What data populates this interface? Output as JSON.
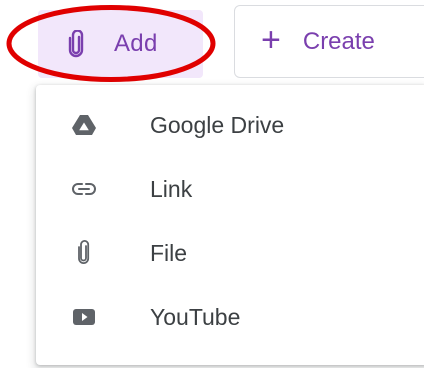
{
  "add_button": {
    "icon": "paperclip-icon",
    "label": "Add",
    "accent_color": "#7a3fae",
    "background_color": "#f2e7fb"
  },
  "create_button": {
    "icon": "plus-icon",
    "label": "Create"
  },
  "highlight": {
    "color": "#e00000",
    "target": "add_button"
  },
  "menu": {
    "items": [
      {
        "icon": "google-drive-icon",
        "label": "Google Drive"
      },
      {
        "icon": "link-icon",
        "label": "Link"
      },
      {
        "icon": "paperclip-icon",
        "label": "File"
      },
      {
        "icon": "youtube-icon",
        "label": "YouTube"
      }
    ]
  }
}
